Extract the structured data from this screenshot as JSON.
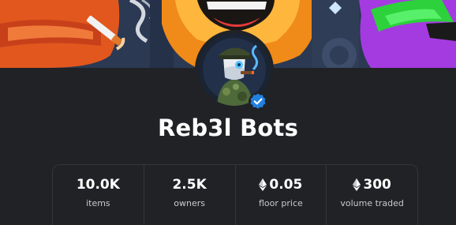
{
  "collection": {
    "name": "Reb3l Bots",
    "verified": true
  },
  "stats": [
    {
      "value": "10.0K",
      "label": "items",
      "currency_icon": ""
    },
    {
      "value": "2.5K",
      "label": "owners",
      "currency_icon": ""
    },
    {
      "value": "0.05",
      "label": "floor price",
      "currency_icon": "ethereum-icon"
    },
    {
      "value": "300",
      "label": "volume traded",
      "currency_icon": "ethereum-icon"
    }
  ],
  "colors": {
    "background": "#202225",
    "verified_badge": "#2081e2",
    "text": "#ffffff",
    "muted_text": "#c8cace"
  }
}
